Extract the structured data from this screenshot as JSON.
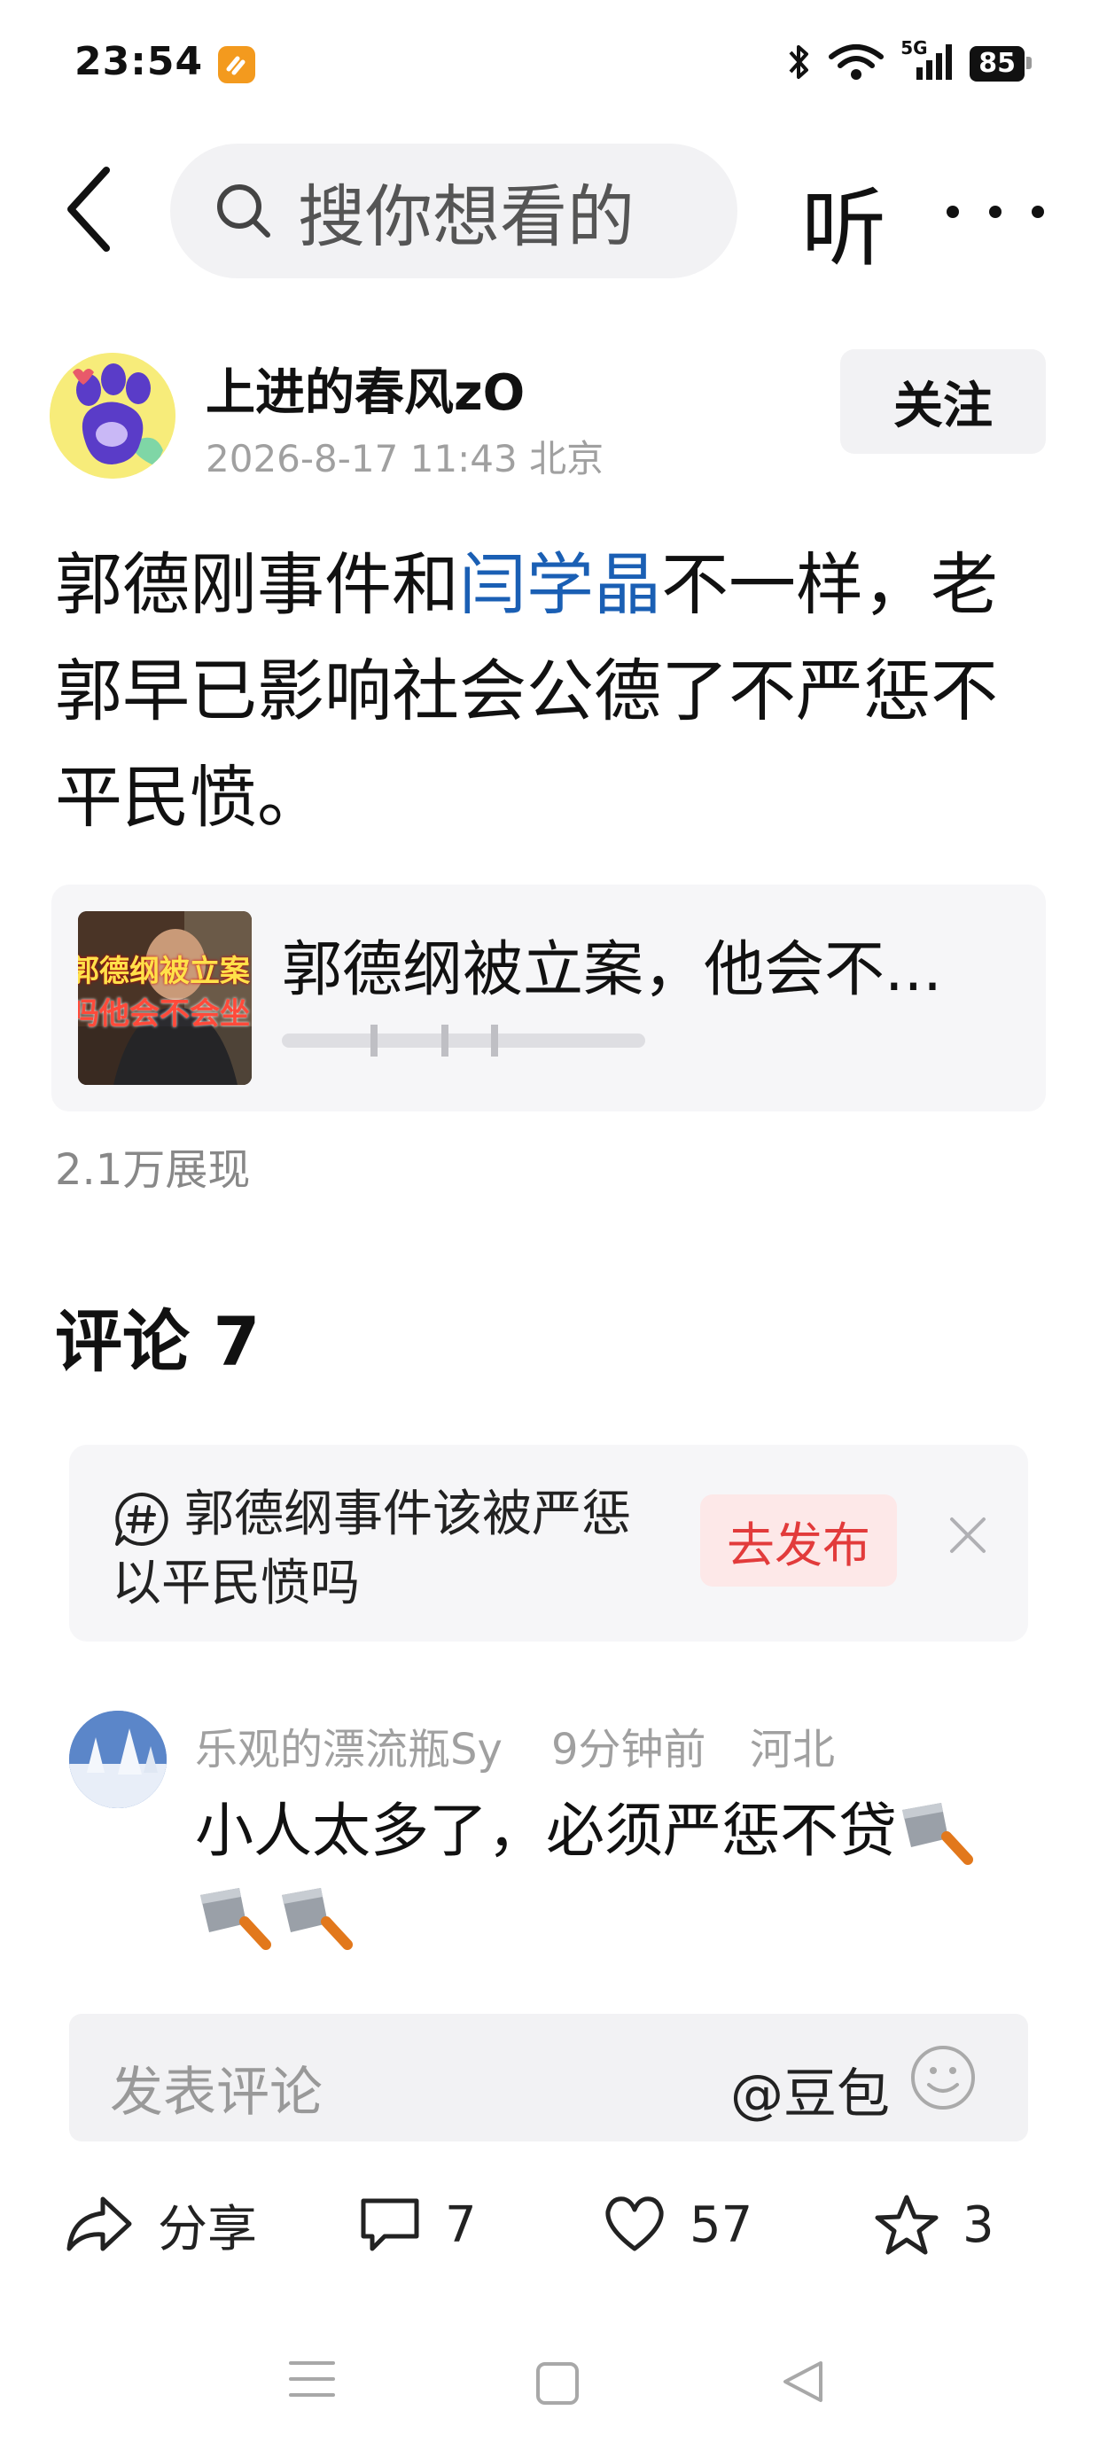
{
  "status_bar": {
    "time": "23:54",
    "network": "5G",
    "battery": "85"
  },
  "top_bar": {
    "search_placeholder": "搜你想看的",
    "listen_label": "听"
  },
  "author": {
    "name": "上进的春风zO",
    "meta": "2026-8-17 11:43 北京",
    "follow_label": "关注"
  },
  "post": {
    "text_part1": "郭德刚事件和",
    "link_text": "闫学晶",
    "text_part2": "不一样，老郭早已影响社会公德了不严惩不平民愤。",
    "link_color": "#1a5fb4"
  },
  "link_card": {
    "title": "郭德纲被立案，他会不...",
    "thumb_caption_1": "郭德纲被立案",
    "thumb_caption_2": "吗他会不会坐"
  },
  "views": "2.1万展现",
  "comments": {
    "title": "评论 7",
    "topic": {
      "text": "郭德纲事件该被严惩以平民愤吗",
      "publish_label": "去发布"
    },
    "items": [
      {
        "user": "乐观的漂流瓶Sy",
        "time": "9分钟前",
        "location": "河北",
        "text": "小人太多了，必须严惩不贷"
      }
    ]
  },
  "comment_input": {
    "placeholder": "发表评论",
    "at_label": "@豆包"
  },
  "actions": {
    "share_label": "分享",
    "comment_count": "7",
    "like_count": "57",
    "favorite_count": "3"
  },
  "colors": {
    "publish_red": "#e23b3b",
    "accent_orange": "#f39a1e"
  }
}
